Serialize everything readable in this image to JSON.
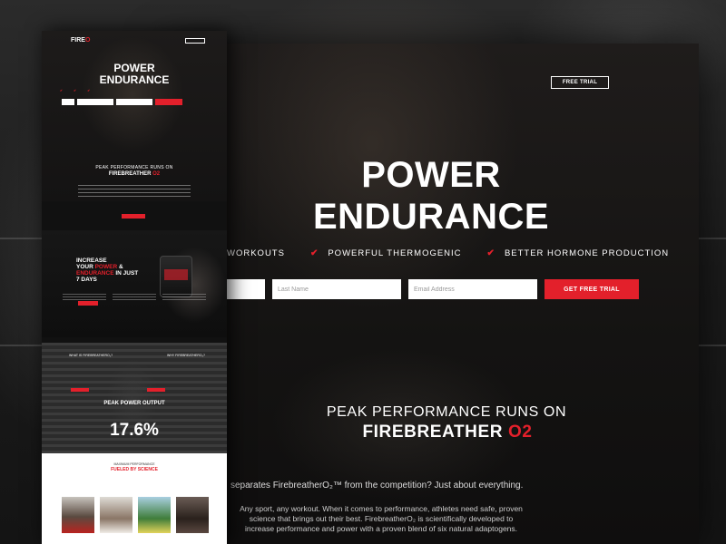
{
  "main": {
    "top_button": "FREE TRIAL",
    "hero_title_line1": "POWER",
    "hero_title_line2": "ENDURANCE",
    "benefits": [
      "WORKOUTS",
      "POWERFUL THERMOGENIC",
      "BETTER HORMONE PRODUCTION"
    ],
    "form": {
      "last_name_placeholder": "Last Name",
      "email_placeholder": "Email Address",
      "submit_label": "GET FREE TRIAL"
    },
    "peak_line1": "PEAK PERFORMANCE RUNS ON",
    "peak_line2_text": "FIREBREATHER ",
    "peak_line2_accent": "O2",
    "compare_text": "separates FirebreatherO₂™ from the competition? Just about everything.",
    "body_copy": "Any sport, any workout. When it comes to performance, athletes need safe, proven science that brings out their best. FirebreatherO₂ is scientifically developed to increase performance and power with a proven blend of six natural adaptogens."
  },
  "mini": {
    "logo": "FIRE",
    "logo_accent": "O",
    "title_line1": "POWER",
    "title_line2": "ENDURANCE",
    "peak_line1": "PEAK PERFORMANCE RUNS ON",
    "peak_line2_text": "FIREBREATHER ",
    "peak_line2_accent": "O2",
    "product_title_1": "INCREASE",
    "product_title_2a": "YOUR ",
    "product_title_2b": "POWER",
    "product_title_2c": " &",
    "product_title_3a": "ENDURANCE",
    "product_title_3b": " IN JUST",
    "product_title_4": "7 DAYS",
    "split_heads": [
      "WHAT IS FIREBREATHERO₂?",
      "WHY FIREBREATHERO₂?"
    ],
    "ppo_title": "PEAK POWER OUTPUT",
    "stat": "17.6%",
    "max_perf": "MAXIMUM PERFORMANCE",
    "fueled": "FUELED BY SCIENCE"
  },
  "colors": {
    "accent": "#e3202b",
    "background": "#1a1a1a"
  }
}
